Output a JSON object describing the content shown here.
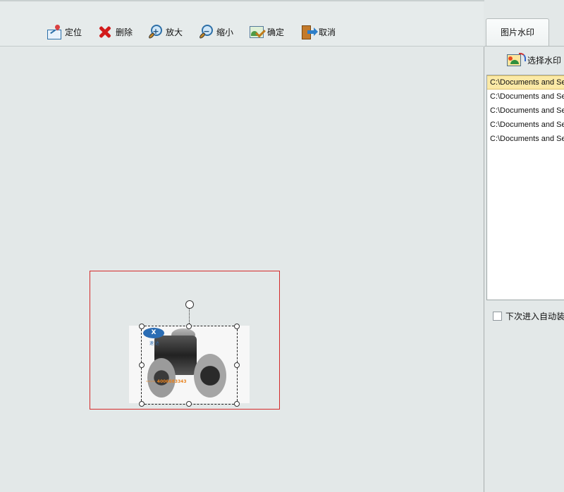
{
  "toolbar": {
    "buttons": [
      {
        "label": "定位",
        "icon": "locate-icon"
      },
      {
        "label": "删除",
        "icon": "delete-icon"
      },
      {
        "label": "放大",
        "icon": "zoom-in-icon"
      },
      {
        "label": "缩小",
        "icon": "zoom-out-icon"
      },
      {
        "label": "确定",
        "icon": "confirm-icon"
      },
      {
        "label": "取消",
        "icon": "cancel-icon"
      }
    ]
  },
  "panel": {
    "tab_label": "图片水印",
    "select_button_label": "选择水印",
    "files": [
      "C:\\Documents and Settings",
      "C:\\Documents and Settings",
      "C:\\Documents and Settings",
      "C:\\Documents and Settings",
      "C:\\Documents and Settings"
    ],
    "autoload_label": "下次进入自动装载"
  },
  "canvas": {
    "watermark_logo": "X",
    "watermark_logo_sub": "速 达",
    "watermark_text": "······ 4006683343"
  },
  "colors": {
    "background": "#e3e8e8",
    "work_area_border": "#d42a2a",
    "selected_row": "#fbe9a6",
    "watermark_text": "#e8821e"
  }
}
